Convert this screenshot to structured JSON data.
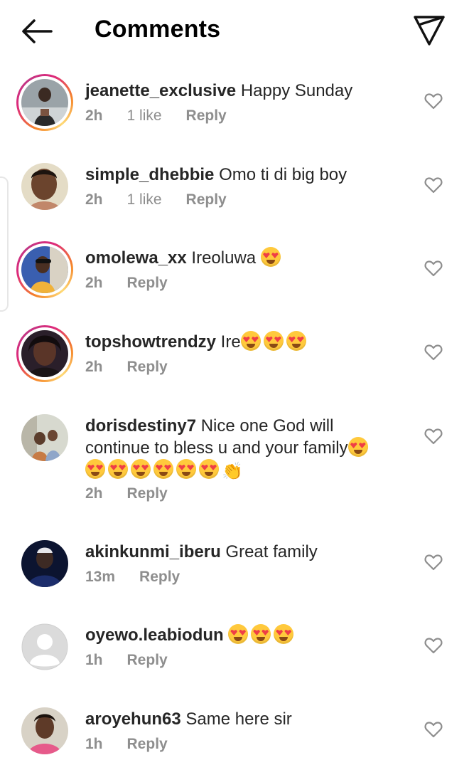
{
  "header": {
    "title": "Comments",
    "back_icon": "arrow-left-icon",
    "share_icon": "send-icon"
  },
  "comments": [
    {
      "username": "jeanette_exclusive",
      "text": "Happy Sunday",
      "emojis_after": 0,
      "time": "2h",
      "likes": "1 like",
      "reply": "Reply",
      "story_ring": true
    },
    {
      "username": "simple_dhebbie",
      "text": "Omo ti di big boy",
      "emojis_after": 0,
      "time": "2h",
      "likes": "1 like",
      "reply": "Reply",
      "story_ring": false
    },
    {
      "username": "omolewa_xx",
      "text": "Ireoluwa",
      "emojis_after": 1,
      "time": "2h",
      "likes": "",
      "reply": "Reply",
      "story_ring": true
    },
    {
      "username": "topshowtrendzy",
      "text": "Ire",
      "emojis_after": 3,
      "time": "2h",
      "likes": "",
      "reply": "Reply",
      "story_ring": true
    },
    {
      "username": "dorisdestiny7",
      "text": "Nice one God will continue to bless u and your family",
      "emojis_after": 7,
      "clap": true,
      "time": "2h",
      "likes": "",
      "reply": "Reply",
      "story_ring": false
    },
    {
      "username": "akinkunmi_iberu",
      "text": "Great family",
      "emojis_after": 0,
      "time": "13m",
      "likes": "",
      "reply": "Reply",
      "story_ring": false
    },
    {
      "username": "oyewo.leabiodun",
      "text": "",
      "emojis_after": 3,
      "time": "1h",
      "likes": "",
      "reply": "Reply",
      "story_ring": false
    },
    {
      "username": "aroyehun63",
      "text": "Same here sir",
      "emojis_after": 0,
      "time": "1h",
      "likes": "",
      "reply": "Reply",
      "story_ring": false
    }
  ],
  "icons": {
    "like": "heart-outline-icon",
    "emoji": "heart-eyes-emoji-icon",
    "clap": "clapping-hands-icon"
  },
  "colors": {
    "story_ring_start": "#f58529",
    "story_ring_end": "#dd2a7b",
    "meta_text": "#8e8e8e"
  }
}
